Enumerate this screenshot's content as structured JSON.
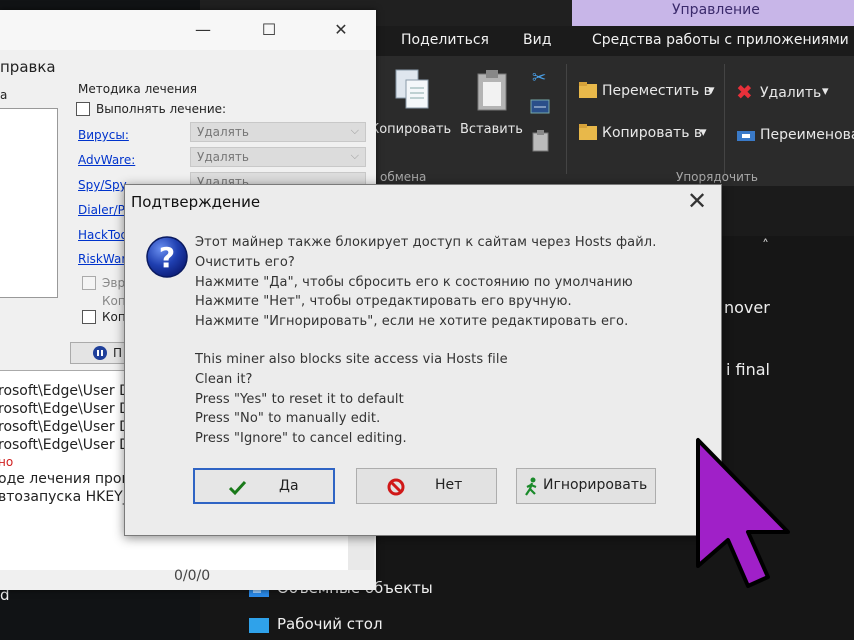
{
  "explorer": {
    "context_tab": "Управление",
    "tabs": [
      "Поделиться",
      "Вид",
      "Средства работы с приложениями"
    ],
    "ribbon": {
      "copy": "Копировать",
      "paste": "Вставить",
      "move_to": "Переместить в",
      "copy_to": "Копировать в",
      "delete": "Удалить",
      "rename": "Переименова",
      "group_clipboard": "обмена",
      "group_organize": "Упорядочить"
    },
    "list_items": [
      "nover",
      "i final"
    ],
    "nav_items": [
      "Объемные объекты",
      "Рабочий стол"
    ],
    "left_partial": "d"
  },
  "antivirus": {
    "menu_label": "правка",
    "left_partial": "a",
    "method_title": "Методика лечения",
    "perform_cure": "Выполнять лечение:",
    "threats": [
      {
        "label": "Вирусы:",
        "action": "Удалять"
      },
      {
        "label": "AdvWare:",
        "action": "Удалять"
      },
      {
        "label": "Spy/Spy",
        "action": "Удалять"
      },
      {
        "label": "Dialer/P",
        "action": ""
      },
      {
        "label": "HackToo",
        "action": ""
      },
      {
        "label": "RiskWar",
        "action": ""
      }
    ],
    "opt_eur": "Эвр",
    "opt_kop1": "Коп",
    "opt_kop2": "Коп",
    "pause_label": "П",
    "log_lines": [
      "rosoft\\Edge\\User Da",
      "rosoft\\Edge\\User Da",
      "rosoft\\Edge\\User Da",
      "rosoft\\Edge\\User Da",
      "но",
      "оде лечения програ",
      "втозапуска HKEY_L"
    ],
    "counter": "0/0/0"
  },
  "dialog": {
    "title": "Подтверждение",
    "message_lines": [
      "Этот майнер также блокирует доступ к сайтам через Hosts файл.",
      "Очистить его?",
      "Нажмите \"Да\", чтобы сбросить его к состоянию по умолчанию",
      "Нажмите \"Нет\", чтобы отредактировать его вручную.",
      "Нажмите \"Игнорировать\", если не хотите редактировать его.",
      "",
      "This miner also blocks site access via Hosts file",
      "Clean it?",
      "Press \"Yes\" to reset it to default",
      "Press \"No\" to manually edit.",
      "Press \"Ignore\" to cancel editing."
    ],
    "buttons": {
      "yes": "Да",
      "no": "Нет",
      "ignore": "Игнорировать"
    }
  },
  "colors": {
    "dialog_bg": "#ececec",
    "default_button_border": "#2f64c4",
    "pointer": "#a020c8",
    "link": "#0033cc",
    "explorer_bg": "#1b1b1b"
  }
}
